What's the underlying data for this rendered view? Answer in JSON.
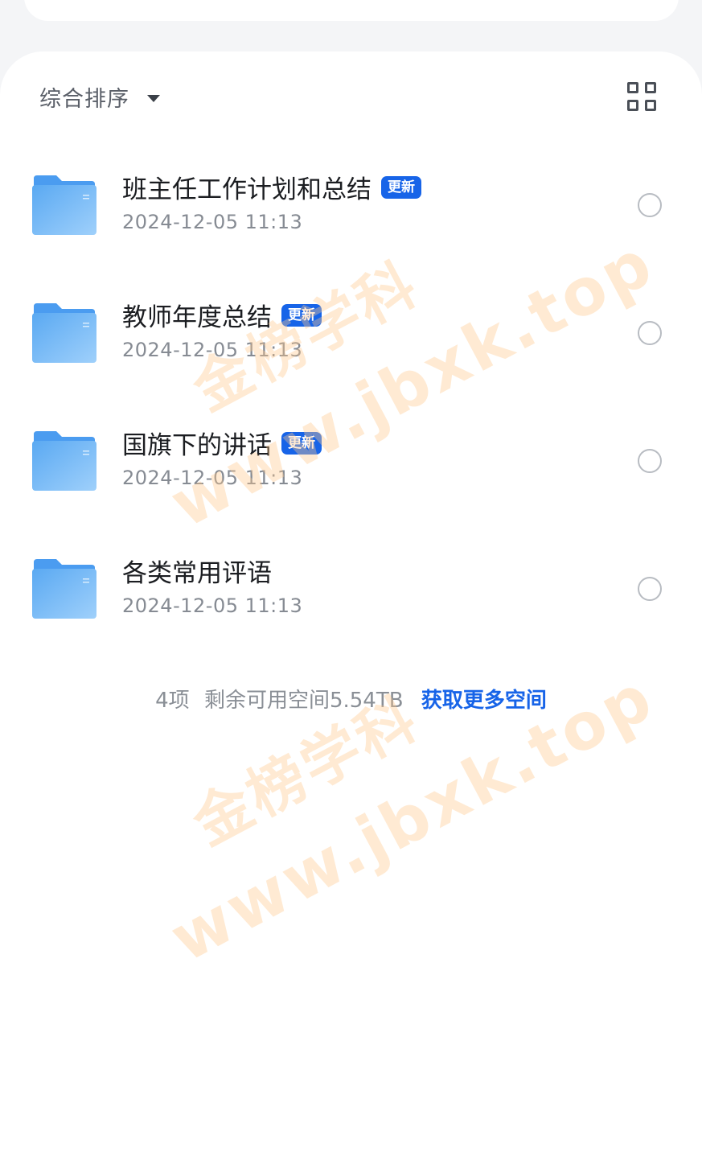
{
  "toolbar": {
    "sort_label": "综合排序",
    "sort_icon": "caret-down-icon",
    "view_icon": "grid-view-icon"
  },
  "files": [
    {
      "name": "班主任工作计划和总结",
      "badge": "更新",
      "date": "2024-12-05 11:13"
    },
    {
      "name": "教师年度总结",
      "badge": "更新",
      "date": "2024-12-05 11:13"
    },
    {
      "name": "国旗下的讲话",
      "badge": "更新",
      "date": "2024-12-05 11:13"
    },
    {
      "name": "各类常用评语",
      "badge": "",
      "date": "2024-12-05 11:13"
    }
  ],
  "footer": {
    "count": "4项",
    "space": "剩余可用空间5.54TB",
    "more_link": "获取更多空间"
  },
  "watermark": {
    "cn": "金榜学科",
    "url": "www.jbxk.top"
  },
  "colors": {
    "accent": "#1764e8",
    "folder": "#5aa9f2",
    "watermark": "#ffc88c"
  }
}
